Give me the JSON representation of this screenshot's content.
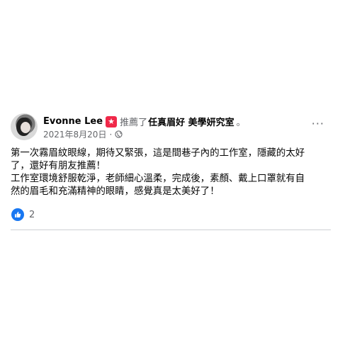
{
  "post": {
    "author": "Evonne Lee",
    "recommends_text": "推薦了",
    "page_name": "任真眉好 美學妍究室",
    "dot": "。",
    "date": "2021年8月20日",
    "separator": "·",
    "body_lines": [
      "第一次霧眉紋眼線，期待又緊張，這是間巷子內的工作室，隱藏的太好",
      "了，還好有朋友推薦！",
      "工作室環境舒服乾淨，老師細心溫柔，完成後，素顏、戴上口罩就有自",
      "然的眉毛和充滿精神的眼睛，感覺真是太美好了！"
    ],
    "reaction_count": "2",
    "accent_color": "#1877f2",
    "badge_color": "#f02849",
    "icons": {
      "badge": "star-badge-icon",
      "privacy": "globe-icon",
      "menu": "more-options-icon",
      "reaction": "like-icon"
    }
  }
}
